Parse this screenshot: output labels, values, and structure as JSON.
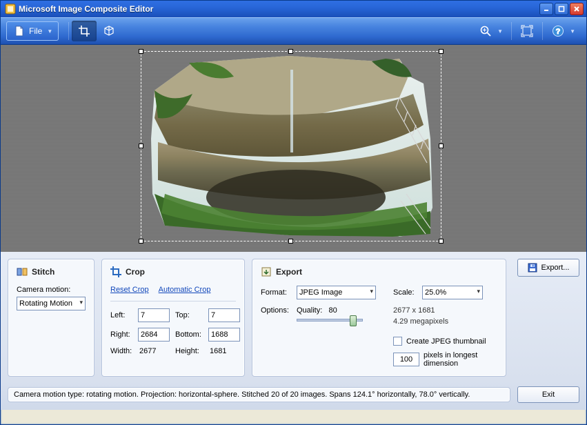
{
  "window": {
    "title": "Microsoft Image Composite Editor"
  },
  "ribbon": {
    "file_label": "File"
  },
  "stitch": {
    "title": "Stitch",
    "camera_motion_label": "Camera motion:",
    "camera_motion_value": "Rotating Motion"
  },
  "crop": {
    "title": "Crop",
    "reset_label": "Reset Crop",
    "auto_label": "Automatic Crop",
    "left_label": "Left:",
    "left_value": "7",
    "top_label": "Top:",
    "top_value": "7",
    "right_label": "Right:",
    "right_value": "2684",
    "bottom_label": "Bottom:",
    "bottom_value": "1688",
    "width_label": "Width:",
    "width_value": "2677",
    "height_label": "Height:",
    "height_value": "1681"
  },
  "export": {
    "title": "Export",
    "button_label": "Export...",
    "format_label": "Format:",
    "format_value": "JPEG Image",
    "options_label": "Options:",
    "quality_label": "Quality:",
    "quality_value": "80",
    "scale_label": "Scale:",
    "scale_value": "25.0%",
    "dims_text": "2677 x 1681",
    "mp_text": "4.29 megapixels",
    "thumb_check_label": "Create JPEG thumbnail",
    "thumb_px_value": "100",
    "thumb_px_label": "pixels in longest dimension"
  },
  "status": {
    "text": "Camera motion type: rotating motion. Projection: horizontal-sphere. Stitched 20 of 20 images. Spans 124.1° horizontally, 78.0° vertically.",
    "exit_label": "Exit"
  }
}
